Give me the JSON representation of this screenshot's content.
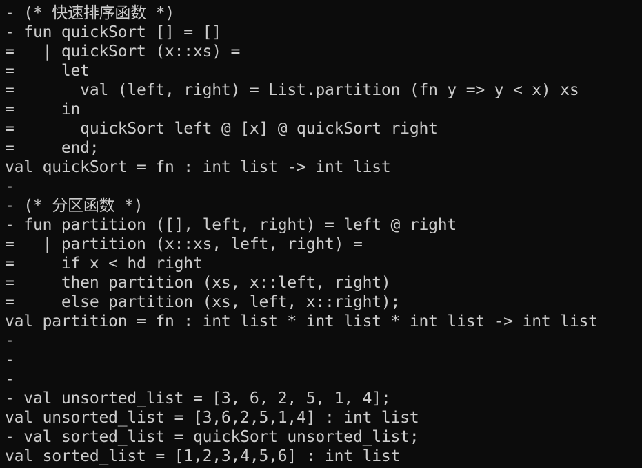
{
  "terminal": {
    "lines": [
      "- (* 快速排序函数 *)",
      "- fun quickSort [] = []",
      "=   | quickSort (x::xs) =",
      "=     let",
      "=       val (left, right) = List.partition (fn y => y < x) xs",
      "=     in",
      "=       quickSort left @ [x] @ quickSort right",
      "=     end;",
      "val quickSort = fn : int list -> int list",
      "-",
      "- (* 分区函数 *)",
      "- fun partition ([], left, right) = left @ right",
      "=   | partition (x::xs, left, right) =",
      "=     if x < hd right",
      "=     then partition (xs, x::left, right)",
      "=     else partition (xs, left, x::right);",
      "val partition = fn : int list * int list * int list -> int list",
      "-",
      "-",
      "-",
      "- val unsorted_list = [3, 6, 2, 5, 1, 4];",
      "val unsorted_list = [3,6,2,5,1,4] : int list",
      "- val sorted_list = quickSort unsorted_list;",
      "val sorted_list = [1,2,3,4,5,6] : int list"
    ]
  },
  "colors": {
    "background": "#0c0c0c",
    "text": "#cccccc"
  }
}
